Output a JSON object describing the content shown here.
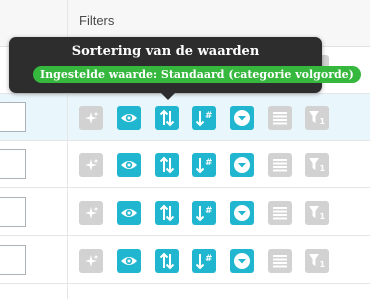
{
  "header": {
    "filters_column_title": "Filters"
  },
  "tooltip": {
    "title": "Sortering van de waarden",
    "badge": "Ingestelde waarde: Standaard (categorie volgorde)"
  },
  "colors": {
    "teal_button": "#20b6cf",
    "disabled_button": "#d2d2d2",
    "row_highlight": "#e9f7fc",
    "tooltip_background": "#2d2d2d",
    "badge_green": "#36b83e"
  },
  "toolbar_icons": [
    {
      "name": "magic-sparkle-icon",
      "state": "disabled"
    },
    {
      "name": "eye-icon",
      "state": "active"
    },
    {
      "name": "sort-arrows-icon",
      "state": "active"
    },
    {
      "name": "sort-numeric-icon",
      "state": "active"
    },
    {
      "name": "dropdown-chevron-icon",
      "state": "active"
    },
    {
      "name": "list-lines-icon",
      "state": "disabled"
    },
    {
      "name": "filter-one-icon",
      "state": "disabled"
    }
  ],
  "rows": [
    {
      "highlighted": true
    },
    {
      "highlighted": false
    },
    {
      "highlighted": false
    },
    {
      "highlighted": false
    }
  ]
}
